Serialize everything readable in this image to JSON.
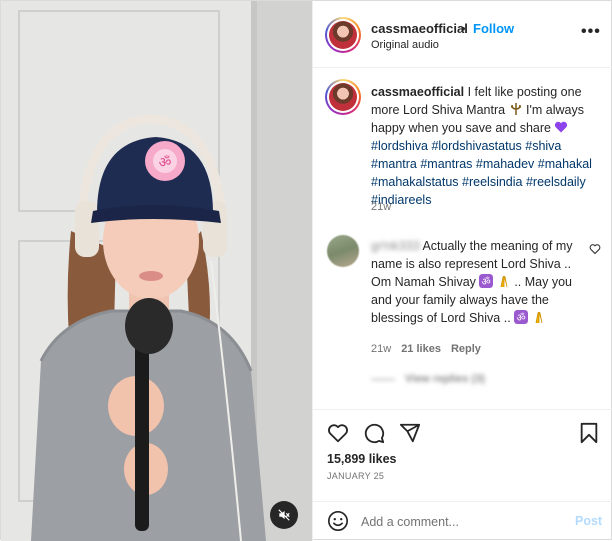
{
  "header": {
    "username": "cassmaeofficial",
    "separator": "•",
    "follow_label": "Follow",
    "audio": "Original audio",
    "more_label": "•••"
  },
  "caption": {
    "username": "cassmaeofficial",
    "text_1": " I felt like posting one more Lord Shiva Mantra ",
    "text_2": " I'm always happy when you save and share ",
    "hashtags": "#lordshiva #lordshivastatus #shiva #mantra #mantras #mahadev #mahakal #mahakalstatus #reelsindia #reelsdaily #indiareels",
    "time": "21w",
    "emoji_1": "trishul-emoji",
    "emoji_2": "purple-heart-emoji"
  },
  "comment": {
    "username": "gr!nk333",
    "text_1": " Actually the meaning of my name is also represent Lord Shiva .. Om Namah Shivay ",
    "text_2": " .. May you and your family always have the blessings of Lord Shiva .. ",
    "time": "21w",
    "likes": "21 likes",
    "reply_label": "Reply",
    "view_replies": "View replies (3)"
  },
  "post": {
    "likes": "15,899 likes",
    "date": "JANUARY 25"
  },
  "add_comment": {
    "placeholder": "Add a comment...",
    "post_label": "Post"
  },
  "colors": {
    "accent": "#0095f6",
    "hashtag": "#00376b",
    "post_disabled": "#b3dbff",
    "secondary_text": "#737373"
  }
}
